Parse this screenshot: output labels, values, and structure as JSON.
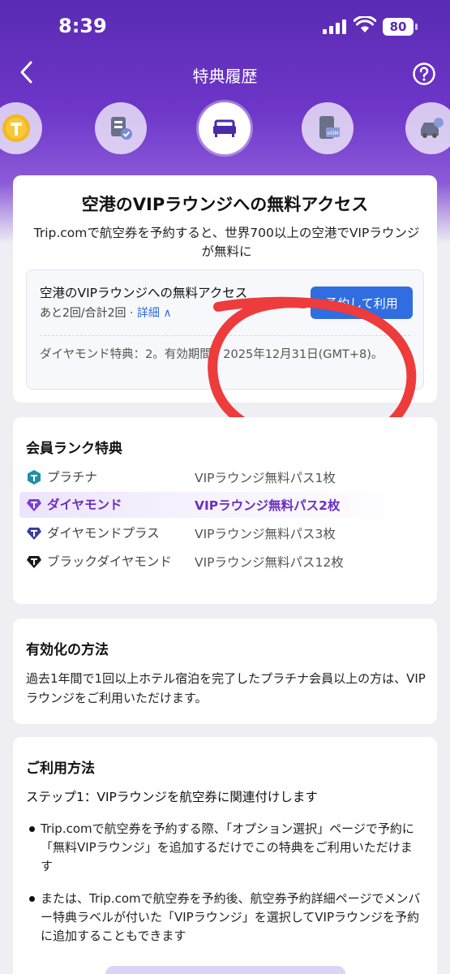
{
  "status": {
    "time": "8:39",
    "battery": "80"
  },
  "nav": {
    "title": "特典履歴"
  },
  "icons": [
    "trip-coin-icon",
    "ticket-icon",
    "lounge-sofa-icon",
    "esim-icon",
    "car-icon"
  ],
  "main_card": {
    "title": "空港のVIPラウンジへの無料アクセス",
    "description": "Trip.comで航空券を予約すると、世界700以上の空港でVIPラウンジが無料に",
    "benefit": {
      "title": "空港のVIPラウンジへの無料アクセス",
      "count": "あと2回/合計2回 · ",
      "details_link": "詳細 ∧",
      "button": "予約して利用",
      "validity": "ダイヤモンド特典：2。有効期間：2025年12月31日(GMT+8)。"
    }
  },
  "ranks": {
    "title": "会員ランク特典",
    "items": [
      {
        "name": "プラチナ",
        "benefit": "VIPラウンジ無料パス1枚",
        "color": "#1f8fa8"
      },
      {
        "name": "ダイヤモンド",
        "benefit": "VIPラウンジ無料パス2枚",
        "color": "#7a3fd6"
      },
      {
        "name": "ダイヤモンドプラス",
        "benefit": "VIPラウンジ無料パス3枚",
        "color": "#3b3f9a"
      },
      {
        "name": "ブラックダイヤモンド",
        "benefit": "VIPラウンジ無料パス12枚",
        "color": "#1a1a1a"
      }
    ]
  },
  "activation": {
    "title": "有効化の方法",
    "text": "過去1年間で1回以上ホテル宿泊を完了したプラチナ会員以上の方は、VIPラウンジをご利用いただけます。"
  },
  "usage": {
    "title": "ご利用方法",
    "step1": "ステップ1：VIPラウンジを航空券に関連付けします",
    "bullets": [
      "Trip.comで航空券を予約する際、「オプション選択」ページで予約に「無料VIPラウンジ」を追加するだけでこの特典をご利用いただけます",
      "または、Trip.comで航空券を予約後、航空券予約詳細ページでメンバー特典ラベルが付いた「VIPラウンジ」を選択してVIPラウンジを予約に追加することもできます"
    ]
  },
  "colors": {
    "accent": "#2f6de0",
    "brand": "#6d36c8",
    "annotation": "#ee3b3b"
  }
}
